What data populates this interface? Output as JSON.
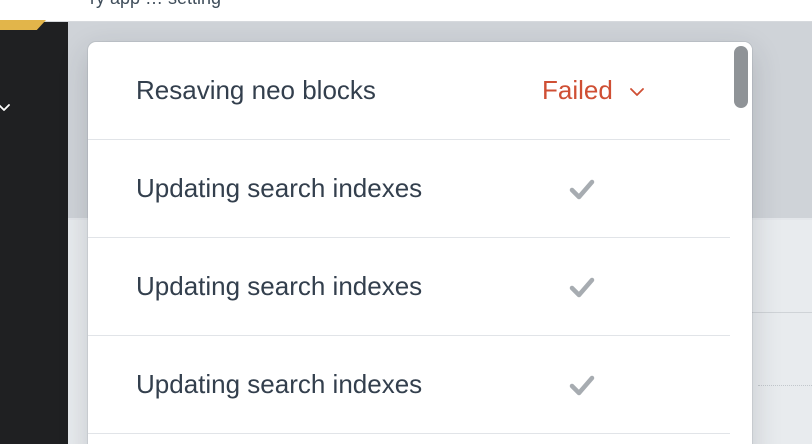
{
  "header": {
    "partial_text": "ry app … setting"
  },
  "icons": {
    "sidebar_chevron": "chevron-down-icon",
    "status_dropdown": "chevron-down-icon",
    "done": "checkmark-icon"
  },
  "colors": {
    "failed": "#cf4f34",
    "check": "#a7acb1",
    "sidebar": "#1f2022",
    "brand": "#e2b54a"
  },
  "jobs": [
    {
      "description": "Resaving neo blocks",
      "status": "Failed"
    },
    {
      "description": "Updating search indexes",
      "status": "done"
    },
    {
      "description": "Updating search indexes",
      "status": "done"
    },
    {
      "description": "Updating search indexes",
      "status": "done"
    }
  ]
}
